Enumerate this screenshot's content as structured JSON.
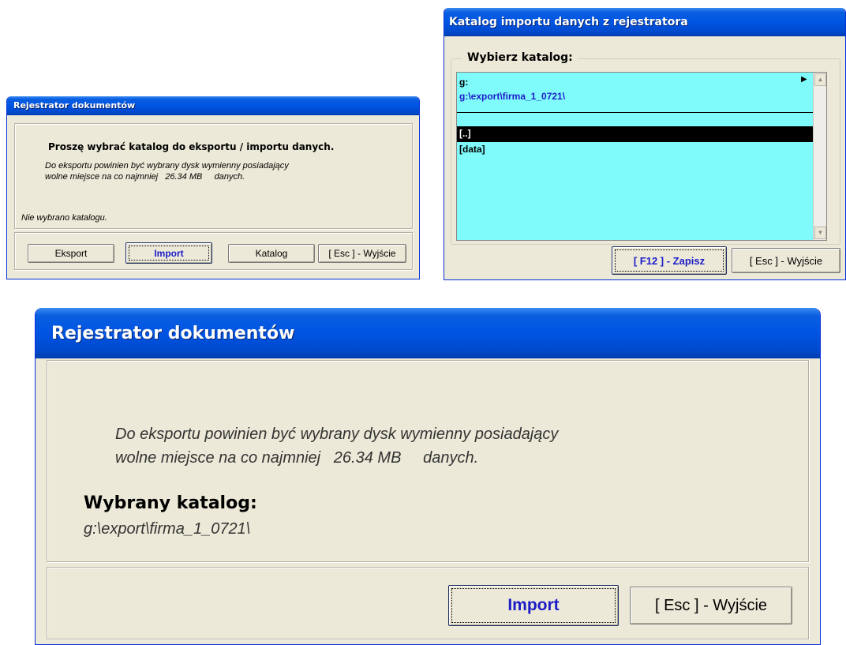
{
  "window1": {
    "title": "Rejestrator dokumentów",
    "heading": "Proszę wybrać katalog do eksportu / importu danych.",
    "info_line1": "Do eksportu powinien być wybrany dysk wymienny posiadający",
    "info_line2": "wolne miejsce na co najmniej   26.34 MB     danych.",
    "status": "Nie wybrano katalogu.",
    "buttons": {
      "export": "Eksport",
      "import": "Import",
      "catalog": "Katalog",
      "exit": "[ Esc ] - Wyjście"
    }
  },
  "window2": {
    "title": "Katalog importu danych z rejestratora",
    "group_label": "Wybierz katalog:",
    "drive": "g:",
    "path": "g:\\export\\firma_1_0721\\",
    "items": [
      "[..]",
      "[data]"
    ],
    "buttons": {
      "save": "[ F12 ] - Zapisz",
      "exit": "[ Esc ] - Wyjście"
    }
  },
  "window3": {
    "title": "Rejestrator dokumentów",
    "info_line1": "Do eksportu powinien być wybrany dysk wymienny posiadający",
    "info_line2": "wolne miejsce na co najmniej   26.34 MB     danych.",
    "selected_label": "Wybrany katalog:",
    "selected_path": "g:\\export\\firma_1_0721\\",
    "buttons": {
      "import": "Import",
      "exit": "[ Esc ] - Wyjście"
    }
  }
}
